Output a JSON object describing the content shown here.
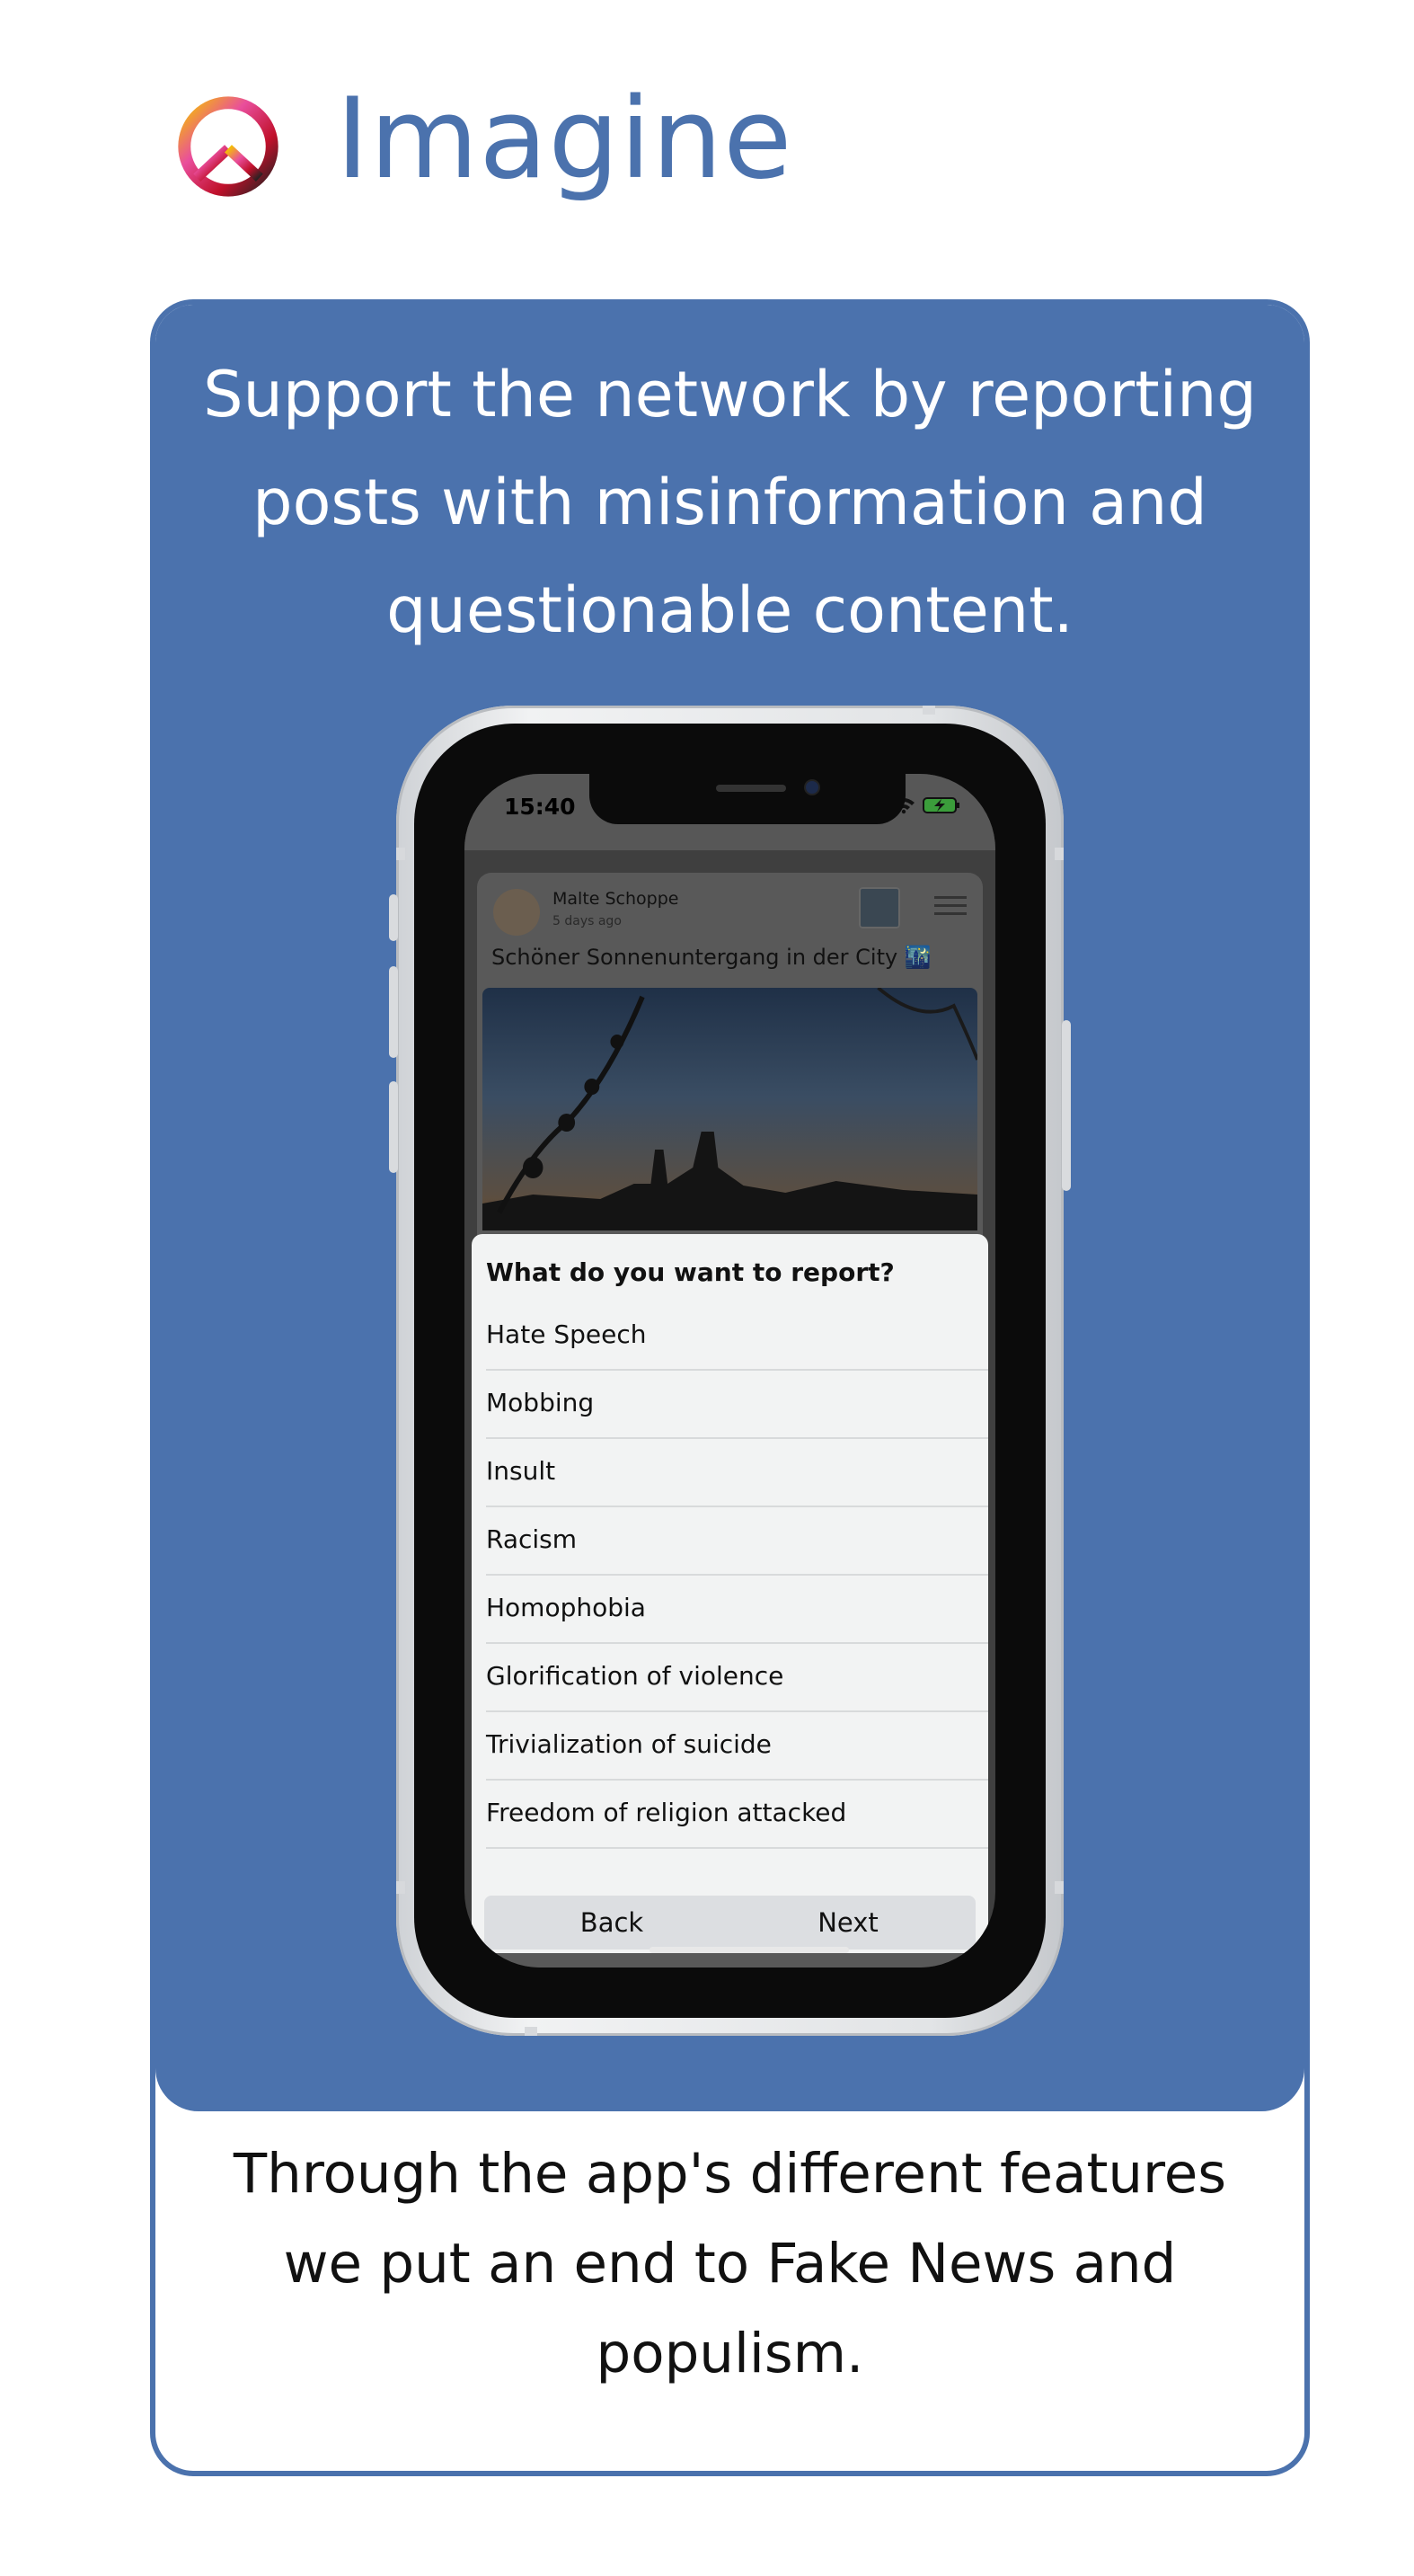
{
  "brand": {
    "title": "Imagine",
    "accent_color": "#4b72ad",
    "logo_icon": "peace-sign-icon"
  },
  "promo": {
    "headline": "Support the network by reporting posts with misinformation and questionable content.",
    "footer": "Through the app's different features we put an end to Fake News and populism."
  },
  "phone": {
    "status": {
      "time": "15:40",
      "icons": "signal-wifi-battery"
    },
    "post": {
      "author": "Malte Schoppe",
      "time_ago": "5 days ago",
      "text": "Schöner Sonnenuntergang in der City 🌃"
    },
    "report_sheet": {
      "title": "What do you want to report?",
      "options": [
        "Hate Speech",
        "Mobbing",
        "Insult",
        "Racism",
        "Homophobia",
        "Glorification of violence",
        "Trivialization of suicide",
        "Freedom of religion attacked"
      ],
      "back_label": "Back",
      "next_label": "Next"
    }
  }
}
